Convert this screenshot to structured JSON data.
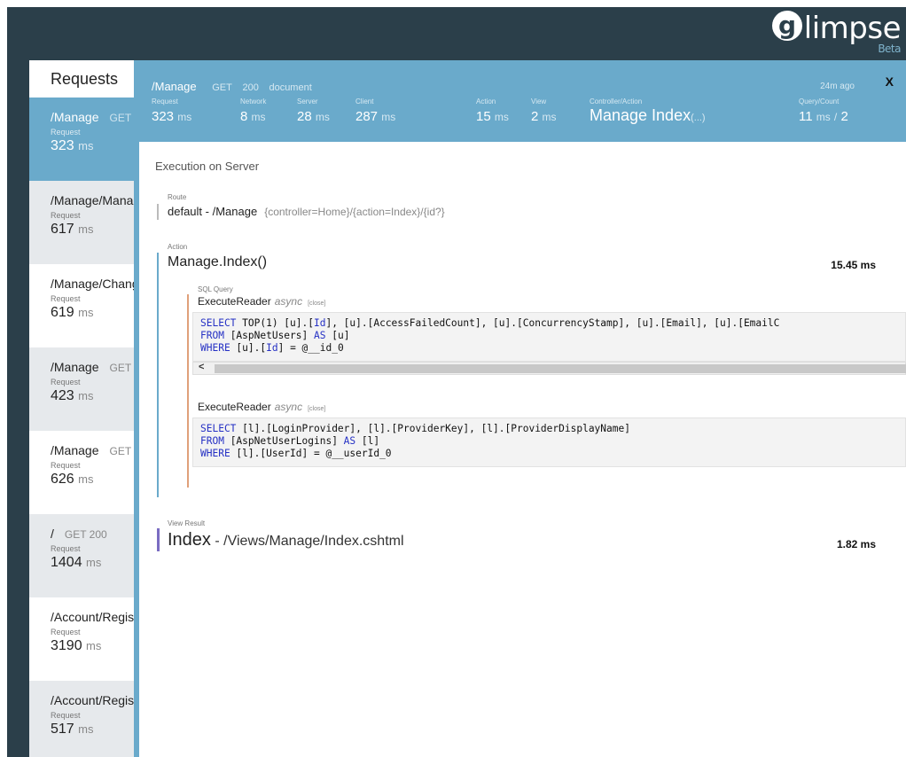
{
  "logo": {
    "text": "limpse",
    "g": "g",
    "beta": "Beta"
  },
  "sidebar": {
    "title": "Requests",
    "items": [
      {
        "path": "/Manage",
        "meta": "GET",
        "label": "Request",
        "ms": "323",
        "unit": "ms"
      },
      {
        "path": "/Manage/Manage",
        "meta": "",
        "label": "Request",
        "ms": "617",
        "unit": "ms"
      },
      {
        "path": "/Manage/Change",
        "meta": "",
        "label": "Request",
        "ms": "619",
        "unit": "ms"
      },
      {
        "path": "/Manage",
        "meta": "GET",
        "label": "Request",
        "ms": "423",
        "unit": "ms"
      },
      {
        "path": "/Manage",
        "meta": "GET",
        "label": "Request",
        "ms": "626",
        "unit": "ms"
      },
      {
        "path": "/",
        "meta": "GET 200",
        "label": "Request",
        "ms": "1404",
        "unit": "ms"
      },
      {
        "path": "/Account/Register",
        "meta": "",
        "label": "Request",
        "ms": "3190",
        "unit": "ms"
      },
      {
        "path": "/Account/Register",
        "meta": "",
        "label": "Request",
        "ms": "517",
        "unit": "ms"
      }
    ]
  },
  "header": {
    "path": "/Manage",
    "method": "GET",
    "status": "200",
    "type": "document",
    "ago": "24m ago",
    "close": "X",
    "stats": {
      "request": {
        "label": "Request",
        "value": "323",
        "unit": "ms"
      },
      "network": {
        "label": "Network",
        "value": "8",
        "unit": "ms"
      },
      "server": {
        "label": "Server",
        "value": "28",
        "unit": "ms"
      },
      "client": {
        "label": "Client",
        "value": "287",
        "unit": "ms"
      },
      "action": {
        "label": "Action",
        "value": "15",
        "unit": "ms"
      },
      "view": {
        "label": "View",
        "value": "2",
        "unit": "ms"
      },
      "controller_action": {
        "label": "Controller/Action",
        "value": "Manage Index",
        "suffix": "(...)"
      },
      "query_count": {
        "label": "Query/Count",
        "value": "11",
        "unit": "ms",
        "sep": "/",
        "count": "2"
      }
    }
  },
  "content": {
    "section_title": "Execution on Server",
    "route": {
      "label": "Route",
      "name": "default - /Manage",
      "template": "{controller=Home}/{action=Index}/{id?}"
    },
    "action": {
      "label": "Action",
      "name": "Manage.Index()",
      "time": "15.45 ms"
    },
    "sql": {
      "label": "SQL Query",
      "queries": [
        {
          "exec": "ExecuteReader",
          "async": "async",
          "close": "[close]",
          "lines": [
            [
              [
                "kw",
                "SELECT"
              ],
              [
                "",
                " TOP(1) [u].["
              ],
              [
                "kw",
                "Id"
              ],
              [
                "",
                "], [u].[AccessFailedCount], [u].[ConcurrencyStamp], [u].[Email], [u].[EmailC"
              ]
            ],
            [
              [
                "kw",
                "FROM"
              ],
              [
                "",
                " [AspNetUsers] "
              ],
              [
                "kw",
                "AS"
              ],
              [
                "",
                " [u]"
              ]
            ],
            [
              [
                "kw",
                "WHERE"
              ],
              [
                "",
                " [u].["
              ],
              [
                "kw",
                "Id"
              ],
              [
                "",
                "] = @__id_0"
              ]
            ]
          ]
        },
        {
          "exec": "ExecuteReader",
          "async": "async",
          "close": "[close]",
          "lines": [
            [
              [
                "kw",
                "SELECT"
              ],
              [
                "",
                " [l].[LoginProvider], [l].[ProviderKey], [l].[ProviderDisplayName]"
              ]
            ],
            [
              [
                "kw",
                "FROM"
              ],
              [
                "",
                " [AspNetUserLogins] "
              ],
              [
                "kw",
                "AS"
              ],
              [
                "",
                " [l]"
              ]
            ],
            [
              [
                "kw",
                "WHERE"
              ],
              [
                "",
                " [l].[UserId] = @__userId_0"
              ]
            ]
          ]
        }
      ],
      "scroll_arrow": "<"
    },
    "view": {
      "label": "View Result",
      "name": "Index",
      "path": " - /Views/Manage/Index.cshtml",
      "time": "1.82 ms"
    }
  }
}
